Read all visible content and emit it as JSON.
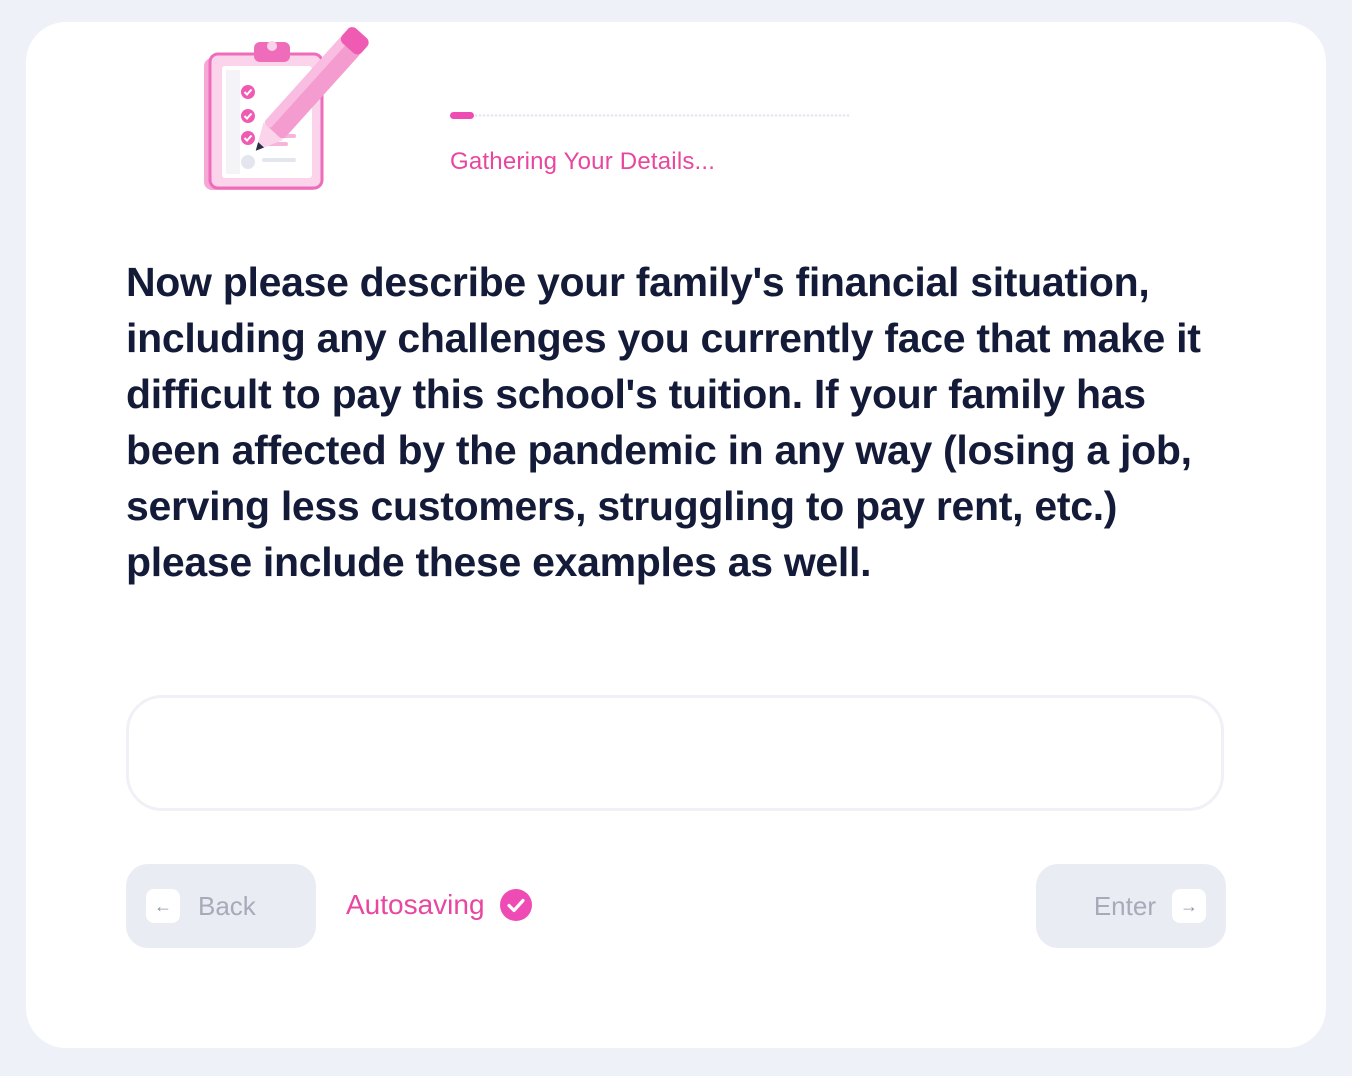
{
  "progress": {
    "fraction": 0.06,
    "stage_label": "Gathering Your Details..."
  },
  "question": {
    "text": "Now please describe your family's financial situation, including any challenges you currently face that make it difficult to pay this school's tuition. If your family has been affected by the pandemic in any way (losing a job, serving less customers, struggling to pay rent, etc.) please include these examples as well."
  },
  "answer": {
    "value": "",
    "placeholder": ""
  },
  "footer": {
    "back_label": "Back",
    "back_key_glyph": "←",
    "autosave_label": "Autosaving",
    "enter_label": "Enter",
    "enter_key_glyph": "→"
  },
  "colors": {
    "accent": "#ee4bb4",
    "heading": "#141b38",
    "button_bg": "#e9ecf3",
    "page_bg": "#eef1f8"
  },
  "icons": {
    "illustration": "clipboard-checklist-pencil-icon",
    "autosave": "check-circle-icon"
  }
}
